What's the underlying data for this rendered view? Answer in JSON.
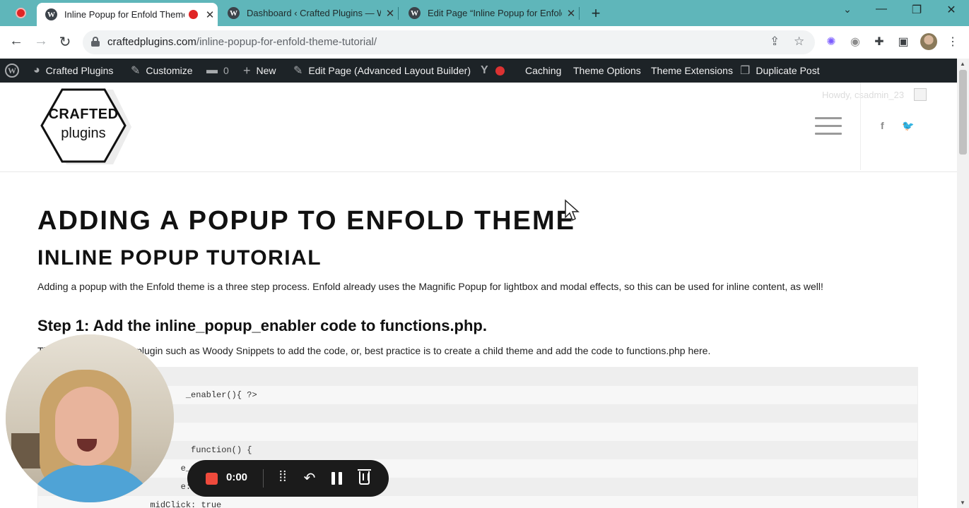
{
  "browser": {
    "tabs": [
      {
        "title": "Inline Popup for Enfold Theme Tutorial",
        "active": true,
        "recording": true
      },
      {
        "title": "Dashboard ‹ Crafted Plugins — WordPress",
        "active": false
      },
      {
        "title": "Edit Page “Inline Popup for Enfold Theme Tutorial”",
        "active": false
      }
    ],
    "new_tab": "+",
    "url_domain": "craftedplugins.com",
    "url_path": "/inline-popup-for-enfold-theme-tutorial/",
    "window_controls": {
      "minimize": "—",
      "restore": "❐",
      "close": "✕",
      "tab_search": "⌄"
    }
  },
  "adminbar": {
    "items": [
      {
        "label": "Crafted Plugins",
        "icon": "dashboard-icon"
      },
      {
        "label": "Customize",
        "icon": "brush-icon"
      },
      {
        "label": "0",
        "icon": "comment-icon"
      },
      {
        "label": "New",
        "icon": "plus-icon"
      },
      {
        "label": "Edit Page (Advanced Layout Builder)",
        "icon": "pencil-icon"
      },
      {
        "label": "Caching",
        "icon": ""
      },
      {
        "label": "Theme Options",
        "icon": ""
      },
      {
        "label": "Theme Extensions",
        "icon": ""
      },
      {
        "label": "Duplicate Post",
        "icon": "duplicate-icon"
      }
    ]
  },
  "site": {
    "logo_line1": "CRAFTED",
    "logo_line2": "plugins",
    "howdy": "Howdy, csadmin_23"
  },
  "article": {
    "title": "ADDING A POPUP TO ENFOLD THEME",
    "subtitle": "INLINE POPUP TUTORIAL",
    "intro": "Adding a popup with the Enfold theme is a three step process. Enfold already uses the Magnific Popup for lightbox and modal effects, so this can be used for inline content, as well!",
    "step1_heading": "Step 1: Add the inline_popup_enabler code to functions.php.",
    "step1_text": "Th                       low. You can use a plugin such as Woody Snippets to add the code, or, best practice is to create a child theme and add the code to functions.php here.",
    "code_lines": [
      "",
      "                             _enabler(){ ?>",
      "",
      "",
      "                              function() {",
      "                            e_popup",
      "                            e:'inline",
      "                      midClick: true"
    ]
  },
  "recorder": {
    "time": "0:00"
  }
}
